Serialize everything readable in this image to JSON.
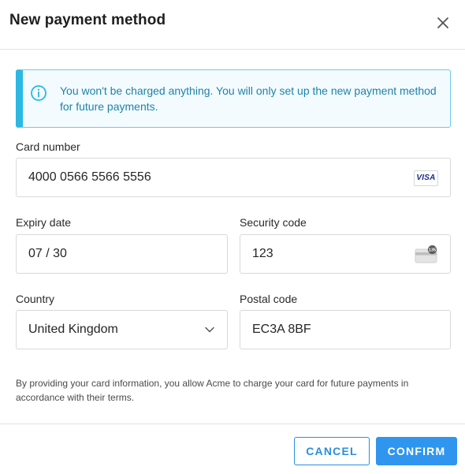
{
  "modal": {
    "title": "New payment method",
    "close_icon": "close-icon"
  },
  "info": {
    "icon": "info-icon",
    "message": "You won't be charged anything. You will only set up the new payment method for future payments."
  },
  "form": {
    "card_number": {
      "label": "Card number",
      "value": "4000 0566 5566 5556",
      "brand": "VISA"
    },
    "expiry": {
      "label": "Expiry date",
      "value": "07 / 30"
    },
    "security": {
      "label": "Security code",
      "value": "123",
      "icon_text": "135"
    },
    "country": {
      "label": "Country",
      "value": "United Kingdom"
    },
    "postal": {
      "label": "Postal code",
      "value": "EC3A 8BF"
    }
  },
  "footnote": "By providing your card information, you allow Acme to charge your card for future payments in accordance with their terms.",
  "buttons": {
    "cancel": "CANCEL",
    "confirm": "CONFIRM"
  },
  "colors": {
    "accent": "#2f95ee",
    "info_border": "#2bb8e3",
    "info_text": "#1c83a8"
  }
}
